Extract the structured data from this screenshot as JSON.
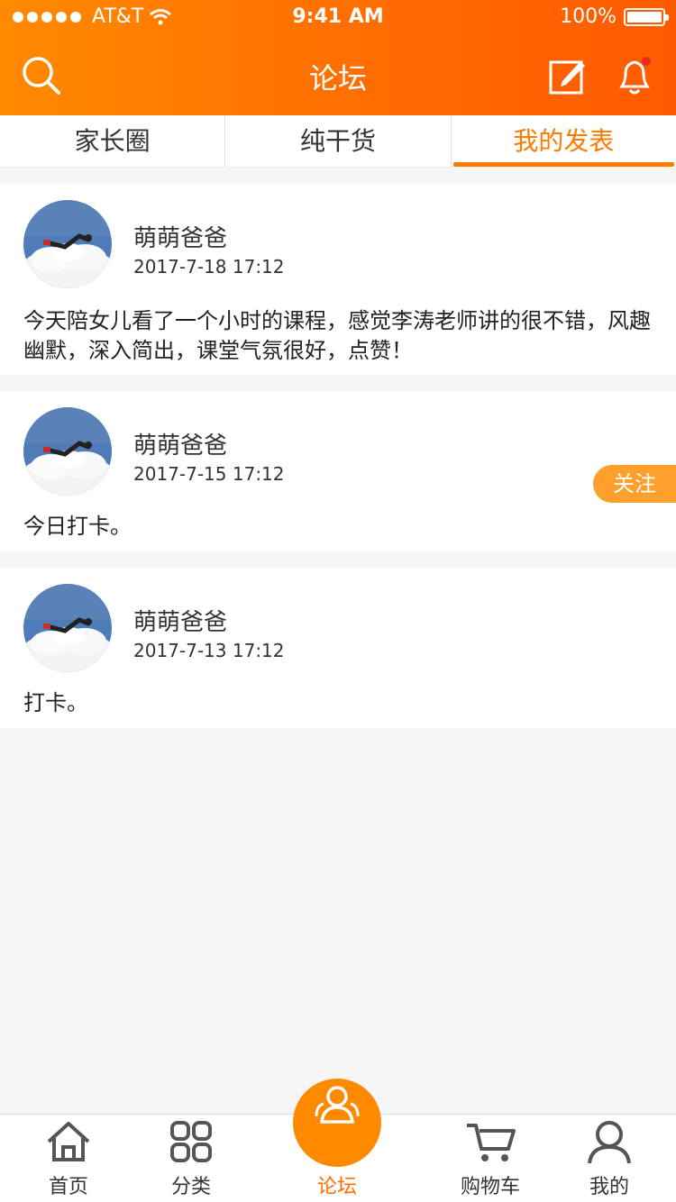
{
  "status": {
    "carrier": "AT&T",
    "time": "9:41 AM",
    "battery": "100%"
  },
  "header": {
    "title": "论坛"
  },
  "tabs": [
    {
      "label": "家长圈"
    },
    {
      "label": "纯干货"
    },
    {
      "label": "我的发表"
    }
  ],
  "posts": [
    {
      "author": "萌萌爸爸",
      "date": "2017-7-18 17:12",
      "content": "今天陪女儿看了一个小时的课程，感觉李涛老师讲的很不错，风趣幽默，深入简出，课堂气氛很好，点赞！"
    },
    {
      "author": "萌萌爸爸",
      "date": "2017-7-15 17:12",
      "content": "今日打卡。",
      "follow": "关注"
    },
    {
      "author": "萌萌爸爸",
      "date": "2017-7-13 17:12",
      "content": "打卡。"
    }
  ],
  "nav": [
    {
      "label": "首页"
    },
    {
      "label": "分类"
    },
    {
      "label": "论坛"
    },
    {
      "label": "购物车"
    },
    {
      "label": "我的"
    }
  ],
  "colors": {
    "accent": "#ff7a00",
    "follow": "#ffa02c"
  }
}
